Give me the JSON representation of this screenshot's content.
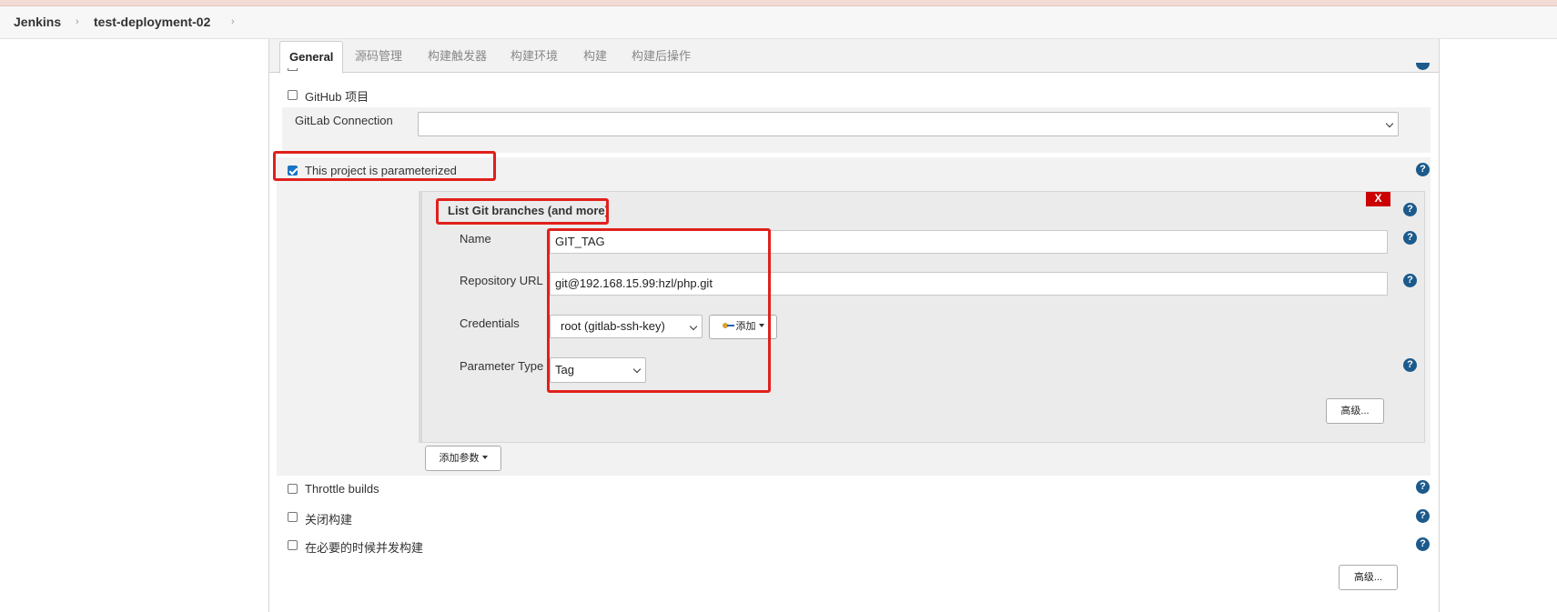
{
  "breadcrumb": {
    "root": "Jenkins",
    "job": "test-deployment-02"
  },
  "tabs": [
    {
      "label": "General"
    },
    {
      "label": "源码管理"
    },
    {
      "label": "构建触发器"
    },
    {
      "label": "构建环境"
    },
    {
      "label": "构建"
    },
    {
      "label": "构建后操作"
    }
  ],
  "general": {
    "github_project": {
      "label": "GitHub 项目",
      "checked": false
    },
    "gitlab_connection": {
      "label": "GitLab Connection",
      "value": ""
    },
    "parameterized": {
      "label": "This project is parameterized",
      "checked": true
    },
    "parameter": {
      "title": "List Git branches (and more)",
      "delete_label": "X",
      "name_label": "Name",
      "name_value": "GIT_TAG",
      "repo_label": "Repository URL",
      "repo_value": "git@192.168.15.99:hzl/php.git",
      "credentials_label": "Credentials",
      "credentials_value": "root (gitlab-ssh-key)",
      "add_credentials_label": "添加",
      "parameter_type_label": "Parameter Type",
      "parameter_type_value": "Tag",
      "advanced_label": "高级..."
    },
    "add_parameter_label": "添加参数",
    "throttle_builds": {
      "label": "Throttle builds",
      "checked": false
    },
    "disable_build": {
      "label": "关闭构建",
      "checked": false
    },
    "concurrent_build": {
      "label": "在必要的时候并发构建",
      "checked": false
    },
    "advanced_label": "高级..."
  },
  "help_icon_glyph": "?",
  "colors": {
    "highlight": "#e0201c",
    "help_icon": "#1c5a8c",
    "checkbox_checked": "#1a73c4",
    "delete_button": "#cc0000"
  }
}
